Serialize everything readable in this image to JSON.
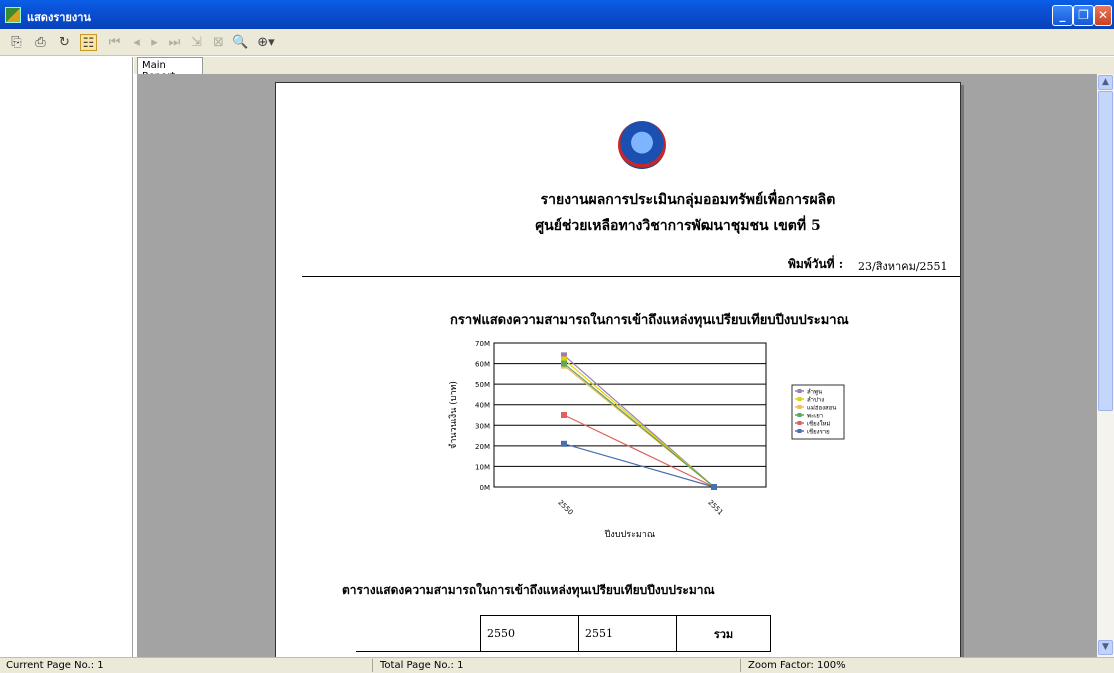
{
  "window": {
    "title": "แสดงรายงาน"
  },
  "toolbar": {
    "icons": [
      "export-icon",
      "print-icon",
      "refresh-icon",
      "group-tree-icon",
      "first-page-icon",
      "prev-page-icon",
      "next-page-icon",
      "last-page-icon",
      "goto-page-icon",
      "close-view-icon",
      "search-icon",
      "zoom-icon"
    ]
  },
  "tabs": [
    {
      "label": "Main Report"
    }
  ],
  "report": {
    "title": "รายงานผลการประเมินกลุ่มออมทรัพย์เพื่อการผลิต",
    "subtitle": "ศูนย์ช่วยเหลือทางวิชาการพัฒนาชุมชน เขตที่ 5",
    "print_label": "พิมพ์วันที่ :",
    "print_date": "23/สิงหาคม/2551",
    "chart_title": "กราฟแสดงความสามารถในการเข้าถึงแหล่งทุนเปรียบเทียบปีงบประมาณ",
    "table_title": "ตารางแสดงความสามารถในการเข้าถึงแหล่งทุนเปรียบเทียบปีงบประมาณ",
    "table_header": [
      "2550",
      "2551",
      "รวม"
    ]
  },
  "chart_data": {
    "type": "line",
    "categories": [
      "2550",
      "2551"
    ],
    "ylabel": "จำนวนเงิน (บาท)",
    "xlabel": "ปีงบประมาณ",
    "y_ticks": [
      "0M",
      "10M",
      "20M",
      "30M",
      "40M",
      "50M",
      "60M",
      "70M"
    ],
    "ylim": [
      0,
      70000000
    ],
    "legend_position": "right",
    "series": [
      {
        "name": "ลำพูน",
        "color": "#9a7fb5",
        "values": [
          64000000,
          0
        ]
      },
      {
        "name": "ลำปาง",
        "color": "#e8d000",
        "values": [
          62000000,
          0
        ]
      },
      {
        "name": "แม่ฮ่องสอน",
        "color": "#f0b860",
        "values": [
          59000000,
          0
        ]
      },
      {
        "name": "พะเยา",
        "color": "#5ca85c",
        "values": [
          60000000,
          0
        ]
      },
      {
        "name": "เชียงใหม่",
        "color": "#e06060",
        "values": [
          35000000,
          0
        ]
      },
      {
        "name": "เชียงราย",
        "color": "#4a6fb0",
        "values": [
          21000000,
          0
        ]
      }
    ]
  },
  "status": {
    "current_page": "Current Page No.: 1",
    "total_page": "Total Page No.: 1",
    "zoom": "Zoom Factor: 100%"
  }
}
